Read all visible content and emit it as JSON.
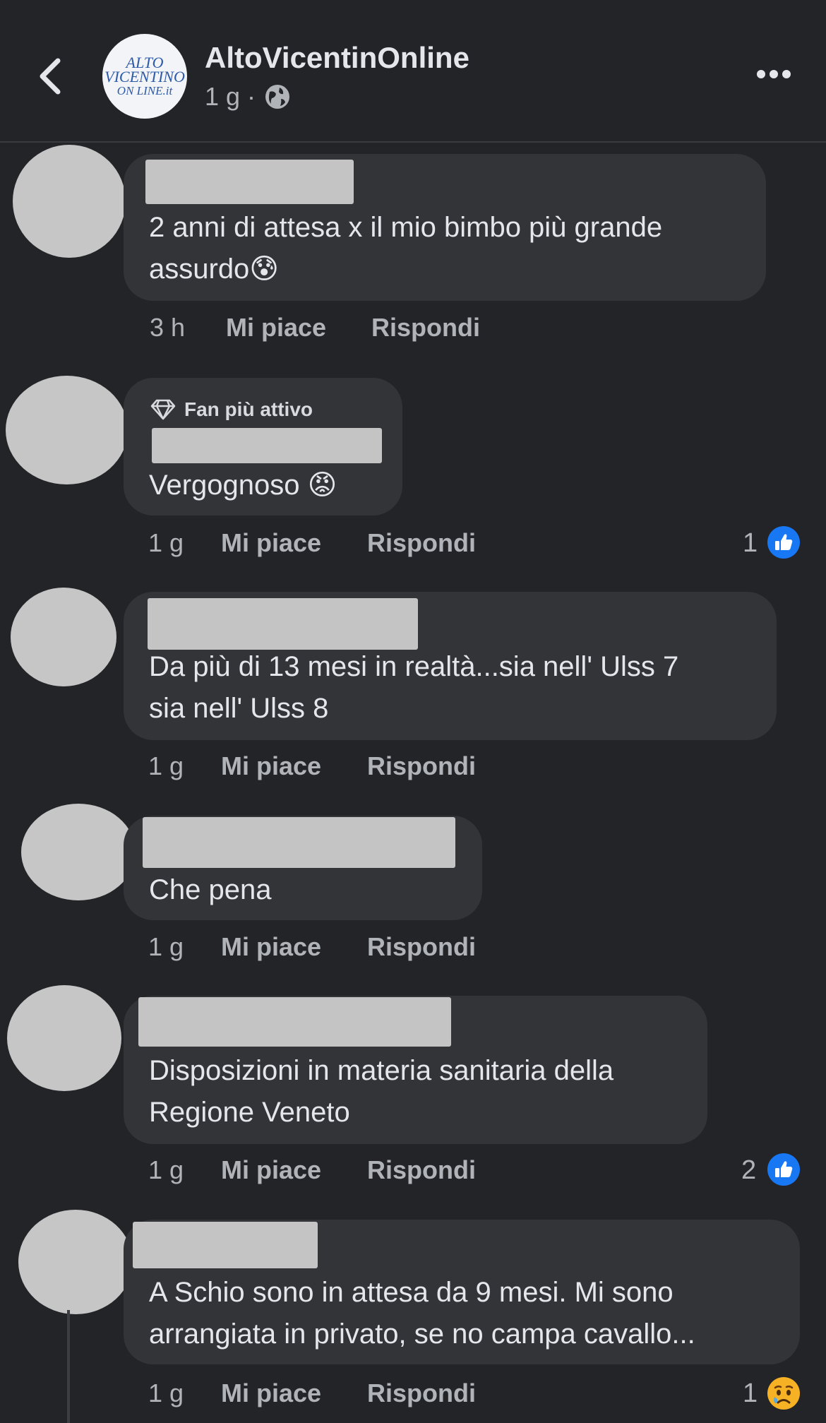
{
  "header": {
    "page_name": "AltoVicentinOnline",
    "meta_time": "1 g ·",
    "logo": {
      "line1": "ALTO",
      "line2": "VICENTINO",
      "line3": "ON LINE.it"
    }
  },
  "comments": [
    {
      "text_lines": [
        "2 anni di attesa x il mio bimbo più grande",
        "assurdo😰"
      ],
      "time": "3 h",
      "like": "Mi piace",
      "reply": "Rispondi"
    },
    {
      "badge": "Fan più attivo",
      "text_lines": [
        "Vergognoso 😡"
      ],
      "time": "1 g",
      "like": "Mi piace",
      "reply": "Rispondi",
      "reaction_count": "1",
      "reaction": "like"
    },
    {
      "text_lines": [
        "Da più di 13 mesi in realtà...sia nell' Ulss 7",
        "sia nell' Ulss 8"
      ],
      "time": "1 g",
      "like": "Mi piace",
      "reply": "Rispondi"
    },
    {
      "text_lines": [
        "Che pena"
      ],
      "time": "1 g",
      "like": "Mi piace",
      "reply": "Rispondi"
    },
    {
      "text_lines": [
        "Disposizioni in materia sanitaria della",
        "Regione Veneto"
      ],
      "time": "1 g",
      "like": "Mi piace",
      "reply": "Rispondi",
      "reaction_count": "2",
      "reaction": "like"
    },
    {
      "text_lines": [
        "A Schio sono in attesa da 9 mesi. Mi sono",
        "arrangiata in privato, se no campa cavallo..."
      ],
      "time": "1 g",
      "like": "Mi piace",
      "reply": "Rispondi",
      "reaction_count": "1",
      "reaction": "sad"
    }
  ],
  "colors": {
    "background": "#232427",
    "bubble": "#333437",
    "like_blue": "#1877f2",
    "text": "#e4e6eb",
    "muted": "#b0b3b8"
  }
}
